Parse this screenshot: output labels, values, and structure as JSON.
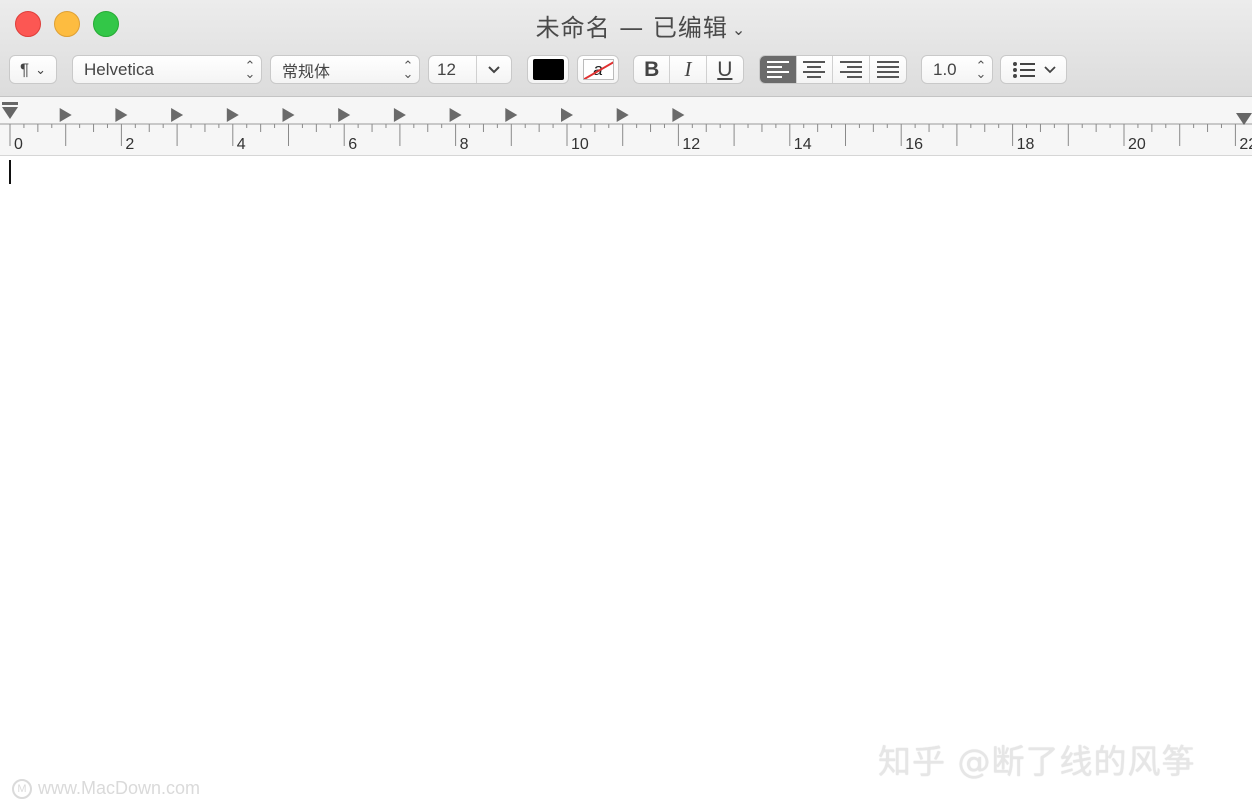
{
  "window": {
    "title": "未命名 — 已编辑"
  },
  "toolbar": {
    "paragraph_symbol": "¶",
    "font_family": "Helvetica",
    "font_style": "常规体",
    "font_size": "12",
    "text_color": "#000000",
    "bold_label": "B",
    "italic_label": "I",
    "underline_label": "U",
    "line_spacing": "1.0",
    "alignment_options": [
      "left",
      "center",
      "right",
      "justify"
    ],
    "active_alignment": "left"
  },
  "ruler": {
    "labels": [
      "0",
      "2",
      "4",
      "6",
      "8",
      "10",
      "12",
      "14",
      "16",
      "18",
      "20",
      "22"
    ]
  },
  "document": {
    "text": ""
  },
  "watermarks": {
    "right": "知乎 @断了线的风筝",
    "left": "www.MacDown.com"
  }
}
